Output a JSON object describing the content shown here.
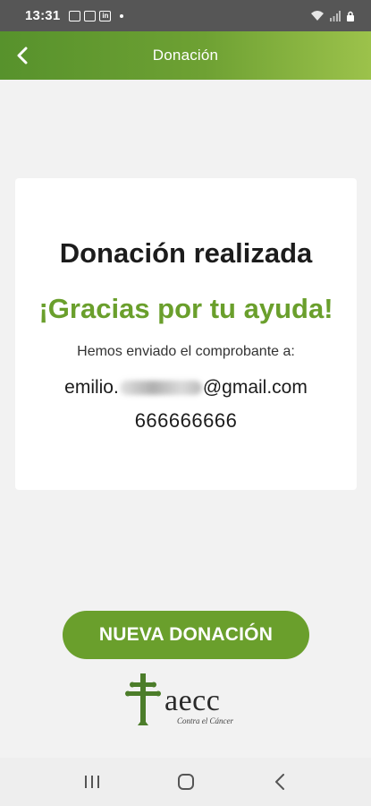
{
  "status_bar": {
    "time": "13:31",
    "notification_icons": [
      "gallery-icon",
      "photos-icon",
      "linkedin-icon"
    ],
    "right_icons": [
      "wifi-icon",
      "signal-icon",
      "lock-icon"
    ]
  },
  "app_bar": {
    "title": "Donación",
    "back_icon": "chevron-left-icon",
    "gradient_colors": [
      "#57922c",
      "#9cc24b"
    ]
  },
  "card": {
    "heading": "Donación realizada",
    "thanks": "¡Gracias por tu ayuda!",
    "sent_text": "Hemos enviado el comprobante a:",
    "email_prefix": "emilio.",
    "email_suffix": "@gmail.com",
    "phone": "666666666"
  },
  "button": {
    "new_donation": "NUEVA DONACIÓN",
    "color": "#6a9f2c"
  },
  "logo": {
    "word": "aecc",
    "subtitle": "Contra el Cáncer"
  },
  "nav_bar": {
    "icons": [
      "recent-apps-icon",
      "home-icon",
      "back-icon"
    ]
  }
}
